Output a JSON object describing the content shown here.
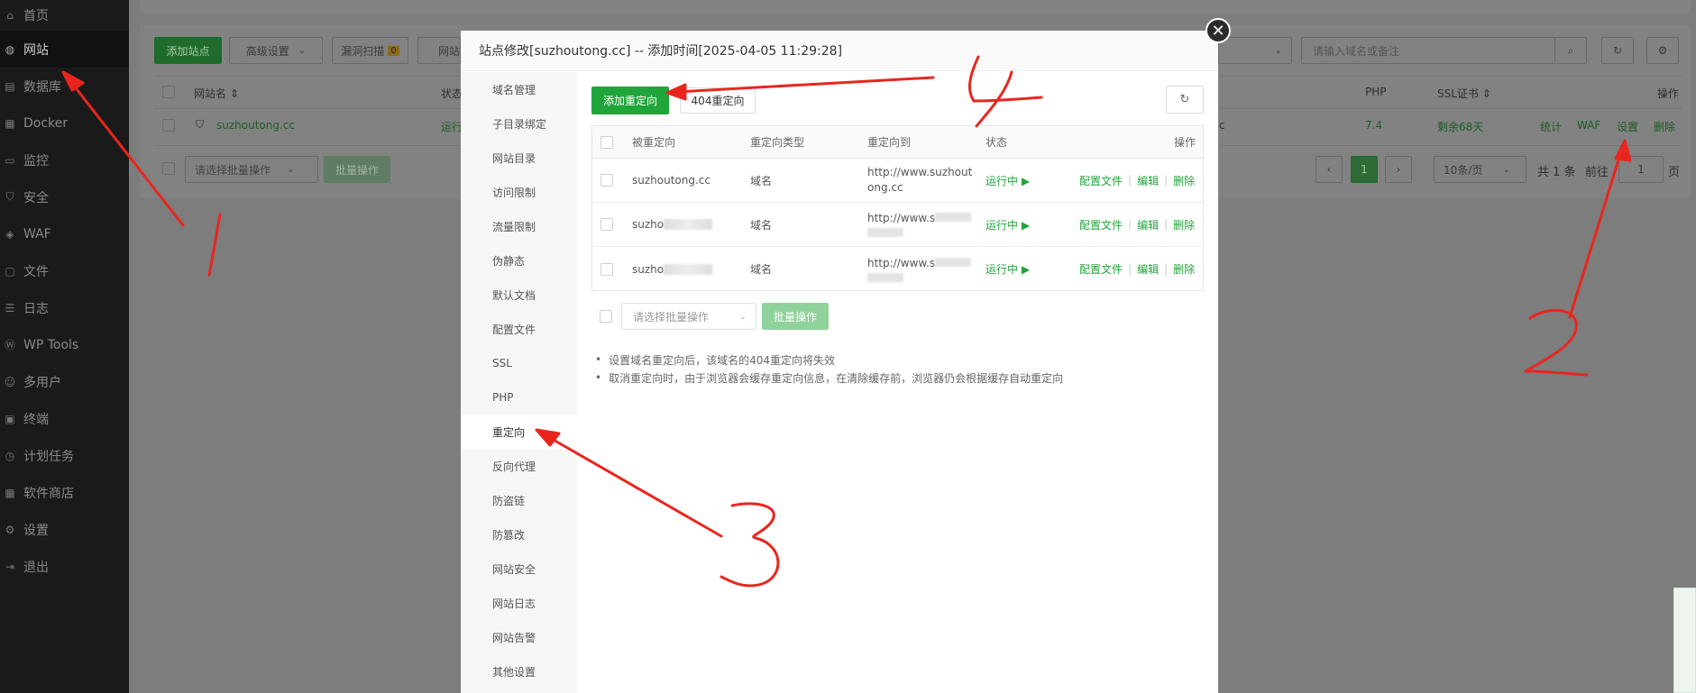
{
  "sidebar": {
    "items": [
      {
        "label": "首页",
        "icon": "home-icon"
      },
      {
        "label": "网站",
        "icon": "globe-icon",
        "active": true
      },
      {
        "label": "数据库",
        "icon": "database-icon"
      },
      {
        "label": "Docker",
        "icon": "docker-icon"
      },
      {
        "label": "监控",
        "icon": "monitor-icon"
      },
      {
        "label": "安全",
        "icon": "shield-icon"
      },
      {
        "label": "WAF",
        "icon": "waf-icon"
      },
      {
        "label": "文件",
        "icon": "folder-icon"
      },
      {
        "label": "日志",
        "icon": "log-icon"
      },
      {
        "label": "WP Tools",
        "icon": "wordpress-icon"
      },
      {
        "label": "多用户",
        "icon": "users-icon"
      },
      {
        "label": "终端",
        "icon": "terminal-icon"
      },
      {
        "label": "计划任务",
        "icon": "clock-icon"
      },
      {
        "label": "软件商店",
        "icon": "store-icon"
      },
      {
        "label": "设置",
        "icon": "gear-icon"
      },
      {
        "label": "退出",
        "icon": "logout-icon"
      }
    ]
  },
  "background": {
    "add_site": "添加站点",
    "advanced": "高级设置",
    "vuln_scan": "漏洞扫描",
    "vuln_count": "0",
    "site_partial": "网站",
    "search_placeholder": "请输入域名或备注",
    "col_name": "网站名 ⇕",
    "col_status": "状态",
    "col_php": "PHP",
    "col_ssl": "SSL证书 ⇕",
    "col_ops": "操作",
    "row_name": "suzhoutong.cc",
    "row_status": "运行",
    "row_c": "c",
    "row_php": "7.4",
    "row_ssl": "剩余68天",
    "row_ops": [
      "统计",
      "WAF",
      "设置",
      "删除"
    ],
    "batch_placeholder": "请选择批量操作",
    "batch_btn": "批量操作",
    "page_current": "1",
    "page_size": "10条/页",
    "total": "共 1 条",
    "goto": "前往",
    "goto_val": "1",
    "page_unit": "页"
  },
  "modal": {
    "title": "站点修改[suzhoutong.cc] -- 添加时间[2025-04-05 11:29:28]",
    "nav": [
      "域名管理",
      "子目录绑定",
      "网站目录",
      "访问限制",
      "流量限制",
      "伪静态",
      "默认文档",
      "配置文件",
      "SSL",
      "PHP",
      "重定向",
      "反向代理",
      "防盗链",
      "防篡改",
      "网站安全",
      "网站日志",
      "网站告警",
      "其他设置"
    ],
    "active_nav": "重定向",
    "add_redirect": "添加重定向",
    "redirect_404": "404重定向",
    "table": {
      "headers": [
        "被重定向",
        "重定向类型",
        "重定向到",
        "状态",
        "操作"
      ],
      "rows": [
        {
          "source": "suzhoutong.cc",
          "type": "域名",
          "target": "http://www.suzhout ong.cc",
          "status": "运行中 ▶"
        },
        {
          "source": "suzho",
          "type": "域名",
          "target": "http://www.s",
          "status": "运行中 ▶"
        },
        {
          "source": "suzho",
          "type": "域名",
          "target": "http://www.s",
          "status": "运行中 ▶"
        }
      ],
      "ops": [
        "配置文件",
        "编辑",
        "删除"
      ]
    },
    "batch_placeholder": "请选择批量操作",
    "batch_btn": "批量操作",
    "notes": [
      "设置域名重定向后，该域名的404重定向将失效",
      "取消重定向时，由于浏览器会缓存重定向信息，在清除缓存前，浏览器仍会根据缓存自动重定向"
    ]
  },
  "annotations": [
    "1",
    "2",
    "3",
    "4"
  ],
  "colors": {
    "accent": "#20a53a",
    "arrow": "#e8261f"
  }
}
